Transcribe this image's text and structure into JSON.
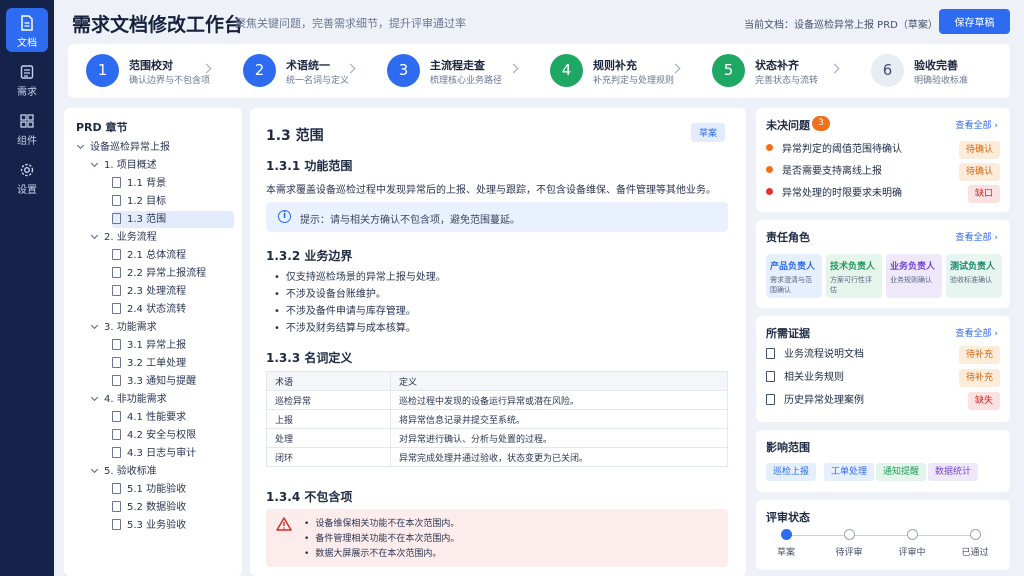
{
  "nav": [
    {
      "label": "文档",
      "icon": "document-icon",
      "active": true
    },
    {
      "label": "需求",
      "icon": "requirement-icon",
      "active": false
    },
    {
      "label": "组件",
      "icon": "grid-icon",
      "active": false
    },
    {
      "label": "设置",
      "icon": "gear-icon",
      "active": false
    }
  ],
  "header": {
    "title": "需求文档修改工作台",
    "subtitle": "聚焦关键问题，完善需求细节，提升评审通过率",
    "current_doc": "当前文档：设备巡检异常上报 PRD（草案）",
    "save_label": "保存草稿"
  },
  "steps": [
    {
      "num": "1",
      "title": "范围校对",
      "desc": "确认边界与不包含项",
      "color": "#2d6cf0"
    },
    {
      "num": "2",
      "title": "术语统一",
      "desc": "统一名词与定义",
      "color": "#2d6cf0"
    },
    {
      "num": "3",
      "title": "主流程走查",
      "desc": "梳理核心业务路径",
      "color": "#2d6cf0"
    },
    {
      "num": "4",
      "title": "规则补充",
      "desc": "补充判定与处理规则",
      "color": "#1fa864"
    },
    {
      "num": "5",
      "title": "状态补齐",
      "desc": "完善状态与流转",
      "color": "#1fa864"
    },
    {
      "num": "6",
      "title": "验收完善",
      "desc": "明确验收标准",
      "color": "#e8ecf3"
    }
  ],
  "tree": {
    "title": "PRD 章节",
    "root": "设备巡检异常上报",
    "sections": [
      {
        "label": "1. 项目概述",
        "items": [
          "1.1 背景",
          "1.2 目标",
          "1.3 范围"
        ]
      },
      {
        "label": "2. 业务流程",
        "items": [
          "2.1 总体流程",
          "2.2 异常上报流程",
          "2.3 处理流程",
          "2.4 状态流转"
        ]
      },
      {
        "label": "3. 功能需求",
        "items": [
          "3.1 异常上报",
          "3.2 工单处理",
          "3.3 通知与提醒"
        ]
      },
      {
        "label": "4. 非功能需求",
        "items": [
          "4.1 性能要求",
          "4.2 安全与权限",
          "4.3 日志与审计"
        ]
      },
      {
        "label": "5. 验收标准",
        "items": [
          "5.1 功能验收",
          "5.2 数据验收",
          "5.3 业务验收"
        ]
      }
    ],
    "selected": "1.3 范围"
  },
  "doc": {
    "title": "1.3 范围",
    "status": "草案",
    "s1_title": "1.3.1 功能范围",
    "s1_text": "本需求覆盖设备巡检过程中发现异常后的上报、处理与跟踪，不包含设备维保、备件管理等其他业务。",
    "hint": "提示：请与相关方确认不包含项，避免范围蔓延。",
    "s2_title": "1.3.2 业务边界",
    "bullets": [
      "仅支持巡检场景的异常上报与处理。",
      "不涉及设备台账维护。",
      "不涉及备件申请与库存管理。",
      "不涉及财务结算与成本核算。"
    ],
    "s3_title": "1.3.3 名词定义",
    "table_headers": [
      "术语",
      "定义"
    ],
    "table_rows": [
      [
        "巡检异常",
        "巡检过程中发现的设备运行异常或潜在风险。"
      ],
      [
        "上报",
        "将异常信息记录并提交至系统。"
      ],
      [
        "处理",
        "对异常进行确认、分析与处置的过程。"
      ],
      [
        "闭环",
        "异常完成处理并通过验收，状态变更为已关闭。"
      ]
    ],
    "s4_title": "1.3.4 不包含项",
    "excludes": [
      "设备维保相关功能不在本次范围内。",
      "备件管理相关功能不在本次范围内。",
      "数据大屏展示不在本次范围内。"
    ]
  },
  "issues": {
    "title": "未决问题",
    "count": "3",
    "see_all": "查看全部",
    "items": [
      {
        "text": "异常判定的阈值范围待确认",
        "tag": "待确认",
        "dot": "#f0701e",
        "tag_bg": "#fdecd9",
        "tag_color": "#d2650f"
      },
      {
        "text": "是否需要支持离线上报",
        "tag": "待确认",
        "dot": "#f0701e",
        "tag_bg": "#fdecd9",
        "tag_color": "#d2650f"
      },
      {
        "text": "异常处理的时限要求未明确",
        "tag": "缺口",
        "dot": "#e0342f",
        "tag_bg": "#fde1e0",
        "tag_color": "#d02b26"
      }
    ]
  },
  "roles": {
    "title": "责任角色",
    "see_all": "查看全部",
    "items": [
      {
        "name": "产品负责人",
        "desc": "需求澄清与范围确认",
        "bg": "#e6effd",
        "color": "#2d6cf0"
      },
      {
        "name": "技术负责人",
        "desc": "方案可行性评估",
        "bg": "#e4f6ec",
        "color": "#1f9a5a"
      },
      {
        "name": "业务负责人",
        "desc": "业务规则确认",
        "bg": "#efe8fb",
        "color": "#7447d6"
      },
      {
        "name": "测试负责人",
        "desc": "验收标准确认",
        "bg": "#e6f5f0",
        "color": "#1a8a6a"
      }
    ]
  },
  "evidence": {
    "title": "所需证据",
    "see_all": "查看全部",
    "items": [
      {
        "text": "业务流程说明文档",
        "tag": "待补充",
        "tag_bg": "#fdecd9",
        "tag_color": "#d2650f"
      },
      {
        "text": "相关业务规则",
        "tag": "待补充",
        "tag_bg": "#fdecd9",
        "tag_color": "#d2650f"
      },
      {
        "text": "历史异常处理案例",
        "tag": "缺失",
        "tag_bg": "#fde1e0",
        "tag_color": "#d02b26"
      }
    ]
  },
  "impact": {
    "title": "影响范围",
    "chips": [
      {
        "label": "巡检上报",
        "bg": "#e6effd",
        "color": "#2d6cf0"
      },
      {
        "label": "工单处理",
        "bg": "#e6effd",
        "color": "#2d6cf0"
      },
      {
        "label": "通知提醒",
        "bg": "#e4f6ec",
        "color": "#1f9a5a"
      },
      {
        "label": "数据统计",
        "bg": "#efe8fb",
        "color": "#7447d6"
      }
    ]
  },
  "review": {
    "title": "评审状态",
    "stages": [
      {
        "label": "草案",
        "done": true
      },
      {
        "label": "待评审",
        "done": false
      },
      {
        "label": "评审中",
        "done": false
      },
      {
        "label": "已通过",
        "done": false
      }
    ]
  }
}
